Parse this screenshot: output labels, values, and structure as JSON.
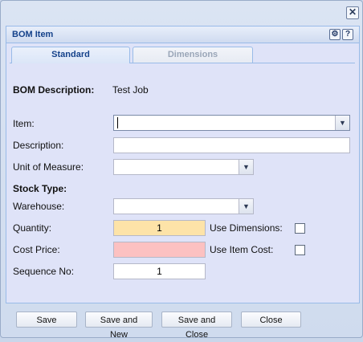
{
  "window": {
    "close_glyph": "✕"
  },
  "panel": {
    "title": "BOM Item",
    "tools": [
      {
        "name": "gear-icon",
        "glyph": "⚙"
      },
      {
        "name": "help-icon",
        "glyph": "?"
      }
    ]
  },
  "tabs": [
    {
      "label": "Standard",
      "active": true
    },
    {
      "label": "Dimensions",
      "active": false
    }
  ],
  "form": {
    "bom_description_label": "BOM Description:",
    "bom_description_value": "Test Job",
    "item_label": "Item:",
    "item_value": "",
    "description_label": "Description:",
    "description_value": "",
    "uom_label": "Unit of Measure:",
    "uom_value": "",
    "stock_type_label": "Stock Type:",
    "warehouse_label": "Warehouse:",
    "warehouse_value": "",
    "quantity_label": "Quantity:",
    "quantity_value": "1",
    "use_dimensions_label": "Use Dimensions:",
    "use_dimensions_checked": false,
    "cost_price_label": "Cost Price:",
    "cost_price_value": "",
    "use_item_cost_label": "Use Item Cost:",
    "use_item_cost_checked": false,
    "sequence_label": "Sequence No:",
    "sequence_value": "1"
  },
  "colors": {
    "quantity_bg": "#fde3a8",
    "cost_price_bg": "#fcc1c1",
    "header_text": "#15428b"
  },
  "buttons": {
    "save": "Save",
    "save_new": "Save and New",
    "save_close": "Save and Close",
    "close": "Close"
  },
  "combo_glyph": "▼"
}
